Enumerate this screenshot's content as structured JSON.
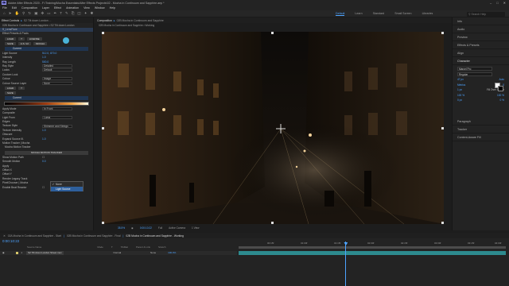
{
  "window": {
    "title": "Adobe After Effects 2020 - F:\\Training\\Mocha Essentials\\After Effects Projects\\02 - Mocha in Continuum and Sapphire.aep *"
  },
  "menu": [
    "File",
    "Edit",
    "Composition",
    "Layer",
    "Effect",
    "Animation",
    "View",
    "Window",
    "Help"
  ],
  "workspaces": [
    "Default",
    "Learn",
    "Standard",
    "Small Screen",
    "Libraries"
  ],
  "search_help_placeholder": "Search Help",
  "effect_controls": {
    "tab_label": "Effect Controls",
    "tab_layer": "S2 Tilt down London ...",
    "layer_path": "02B Mocha in Continuum and Sapphire • S2 Tilt down London",
    "effect_name": "S_LensFlare",
    "effect_preset_label": "Effect Presets & Pools",
    "buttons_row1": [
      "LOAD",
      "?",
      "LICENSE"
    ],
    "buttons_row2": [
      "SAVE",
      "A.S. V2",
      "MOCHA"
    ],
    "current_label": "Current",
    "rows": [
      {
        "label": "Light Source",
        "value": "512.0, 870.0"
      },
      {
        "label": "Intensity",
        "value": "1.0"
      },
      {
        "label": "Ray Length",
        "value": "500.0"
      },
      {
        "label": "Ray Style",
        "dropdown": "Detailed"
      },
      {
        "label": "Looks",
        "dropdown": "Default"
      },
      {
        "label": "Custom Look",
        "value": ""
      },
      {
        "label": "Colour",
        "dropdown": "Image"
      },
      {
        "label": "Colour Source Layer",
        "dropdown": "None"
      }
    ],
    "buttons_row3": [
      "LOAD",
      "?"
    ],
    "buttons_row4": [
      "SAVE"
    ],
    "current_label_2": "Current",
    "rows2": [
      {
        "label": "Apply Mode",
        "dropdown": "In Front"
      },
      {
        "label": "Composite",
        "value": ""
      },
      {
        "label": "Light From",
        "dropdown": "Luma"
      },
      {
        "label": "Edges",
        "value": ""
      },
      {
        "label": "Texture Style",
        "dropdown": "Shimmer and Strings"
      },
      {
        "label": "Texture Intensity",
        "value": "1.0"
      },
      {
        "label": "Obscure",
        "value": ""
      },
      {
        "label": "Expand Source Ill.",
        "value": "1.0"
      },
      {
        "label": "Motion Tracker | Mocha",
        "value": ""
      }
    ],
    "mocha_tracker_label": "Mocha Motion Tracker",
    "mocha_button": "MOCHA MOTION TRACKER",
    "rows3": [
      {
        "label": "Show Motion Path",
        "value": ""
      },
      {
        "label": "Smooth Motion",
        "value": "0.0"
      },
      {
        "label": "Apply",
        "value": ""
      },
      {
        "label": "Offset X",
        "value": ""
      },
      {
        "label": "Offset Y",
        "value": ""
      },
      {
        "label": "Render Legacy Track",
        "value": ""
      },
      {
        "label": "PixelChooser | Mocha",
        "value": ""
      },
      {
        "label": "Enable Beat Reactor",
        "value": ""
      }
    ],
    "dropdown_header": "None",
    "dropdown_options": [
      "None",
      "Light Source"
    ],
    "dropdown_selected": "Light Source"
  },
  "composition": {
    "tab_label": "Composition",
    "tab_name": "02B Mocha in Continuum and Sapphire",
    "sub_label": "02B Mocha in Continuum and Sapphire • Working",
    "zoom": "35.5%",
    "timecode": "0:00:10:22",
    "quality": "Full",
    "camera": "Active Camera",
    "views": "1 View"
  },
  "right_panel": {
    "items": [
      "Info",
      "Audio",
      "Preview",
      "Effects & Presets",
      "Align"
    ],
    "character_label": "Character",
    "font_family": "Marcel Pro",
    "font_style": "Regular",
    "font_size": "47 px",
    "leading": "Auto",
    "kerning": "Metrics",
    "tracking": "0",
    "stroke": "1 px",
    "stroke_type": "Fill Over Stroke",
    "scale_v": "100 %",
    "scale_h": "100 %",
    "baseline": "0 px",
    "tsume": "0 %",
    "lower_items": [
      "Paragraph",
      "Tracker",
      "Content-Aware Fill"
    ],
    "swatch_colors": [
      "#ffffff",
      "#000000",
      "#ff2020"
    ]
  },
  "timeline": {
    "tabs": [
      "02A Mocha in Continuum and Sapphire - Start",
      "02B Mocha in Continuum and Sapphire - Final",
      "02B Mocha in Continuum and Sapphire - Working"
    ],
    "active_tab_index": 2,
    "timecode": "0:00:10:22",
    "header_cols": [
      "Source Name",
      "Mode",
      "T",
      "TrkMat",
      "Parent & Link",
      "Stretch"
    ],
    "layer": {
      "num": "1",
      "name": "S2 Tilt down London Street.mov",
      "mode": "Normal",
      "parent": "None",
      "stretch": "100.0%"
    },
    "ruler_ticks": [
      "00:15f",
      "01:00f",
      "01:15f",
      "02:00f",
      "02:15f",
      "03:00f",
      "03:15f",
      "04:00f"
    ],
    "playhead_fraction": 0.4
  }
}
